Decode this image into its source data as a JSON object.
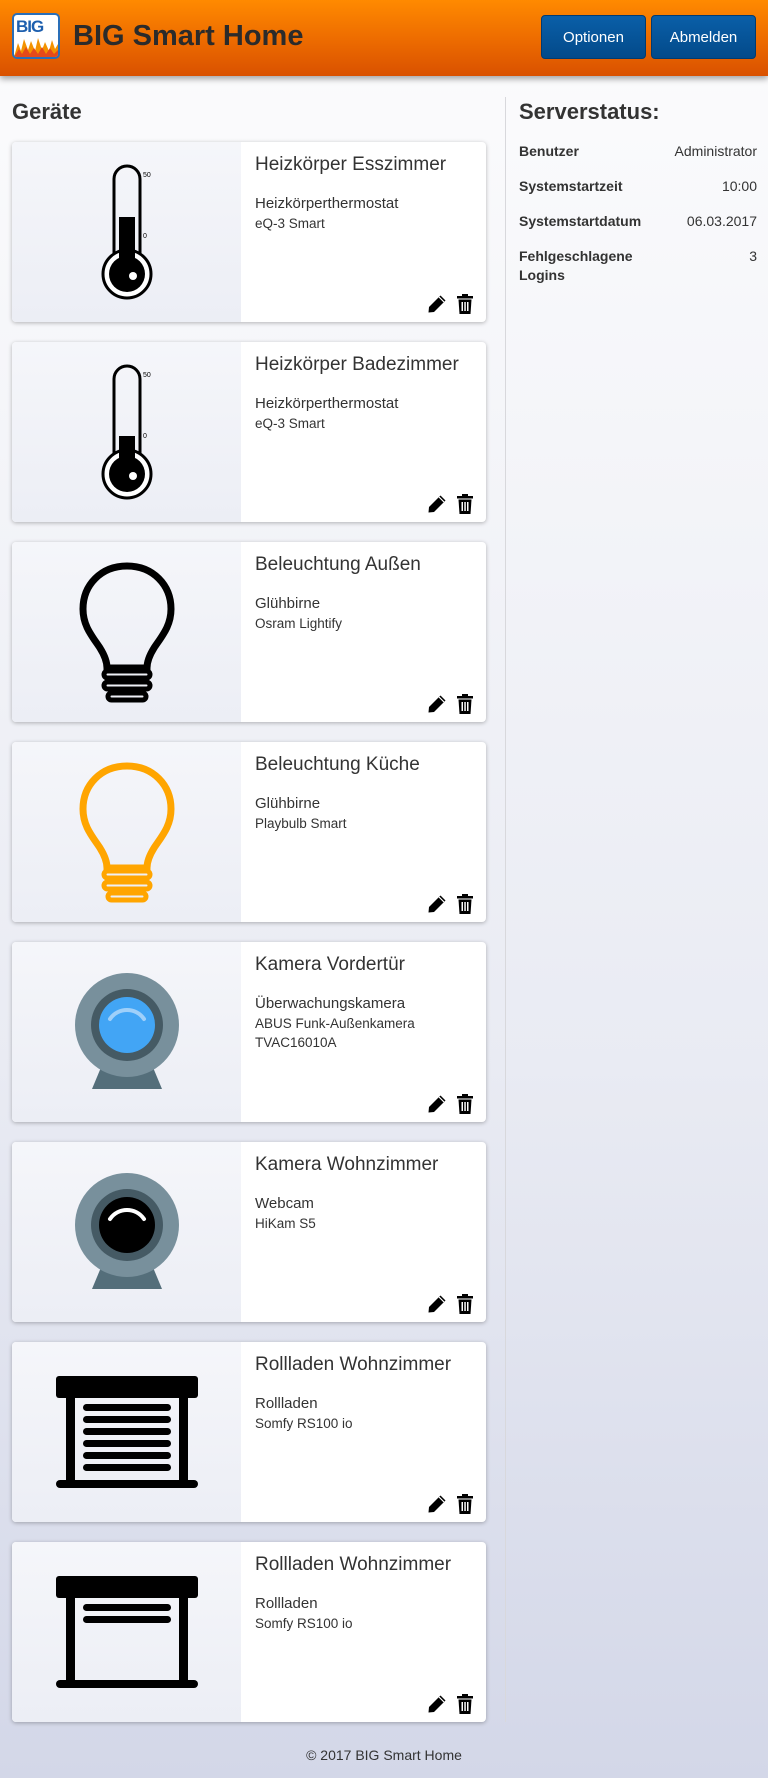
{
  "header": {
    "logo_text": "BIG",
    "title": "BIG Smart Home",
    "options_label": "Optionen",
    "logout_label": "Abmelden"
  },
  "devices_title": "Geräte",
  "devices": [
    {
      "name": "Heizkörper Esszimmer",
      "type": "Heizkörperthermostat",
      "model": "eQ-3 Smart",
      "icon": "thermometer-icon",
      "level_fraction": 0.55,
      "scale_max": "50",
      "scale_zero": "0"
    },
    {
      "name": "Heizkörper Badezimmer",
      "type": "Heizkörperthermostat",
      "model": "eQ-3 Smart",
      "icon": "thermometer-icon",
      "level_fraction": 0.36,
      "scale_max": "50",
      "scale_zero": "0"
    },
    {
      "name": "Beleuchtung Außen",
      "type": "Glühbirne",
      "model": "Osram Lightify",
      "icon": "light-bulb-off-icon",
      "color": "#000000"
    },
    {
      "name": "Beleuchtung Küche",
      "type": "Glühbirne",
      "model": "Playbulb Smart",
      "icon": "light-bulb-on-icon",
      "color": "#ffa500"
    },
    {
      "name": "Kamera Vordertür",
      "type": "Überwachungskamera",
      "model": "ABUS Funk-Außenkamera TVAC16010A",
      "icon": "security-camera-icon",
      "lens_color": "#42a5f5"
    },
    {
      "name": "Kamera Wohnzimmer",
      "type": "Webcam",
      "model": "HiKam S5",
      "icon": "webcam-icon",
      "lens_color": "#000000"
    },
    {
      "name": "Rollladen Wohnzimmer",
      "type": "Rollladen",
      "model": "Somfy RS100 io",
      "icon": "shutter-closed-icon",
      "slats_shown": 6
    },
    {
      "name": "Rollladen Wohnzimmer",
      "type": "Rollladen",
      "model": "Somfy RS100 io",
      "icon": "shutter-open-icon",
      "slats_shown": 2
    }
  ],
  "server_status": {
    "title": "Serverstatus:",
    "rows": [
      {
        "key": "Benutzer",
        "value": "Administrator"
      },
      {
        "key": "Systemstartzeit",
        "value": "10:00"
      },
      {
        "key": "Systemstartdatum",
        "value": "06.03.2017"
      },
      {
        "key": "Fehlgeschlagene Logins",
        "value": "3"
      }
    ]
  },
  "footer": "© 2017 BIG Smart Home",
  "colors": {
    "header_orange": "#ff8a00",
    "button_blue": "#0a5fa8",
    "bulb_on": "#ffa500",
    "camera_gray": "#78909c",
    "camera_lens_blue": "#42a5f5"
  }
}
